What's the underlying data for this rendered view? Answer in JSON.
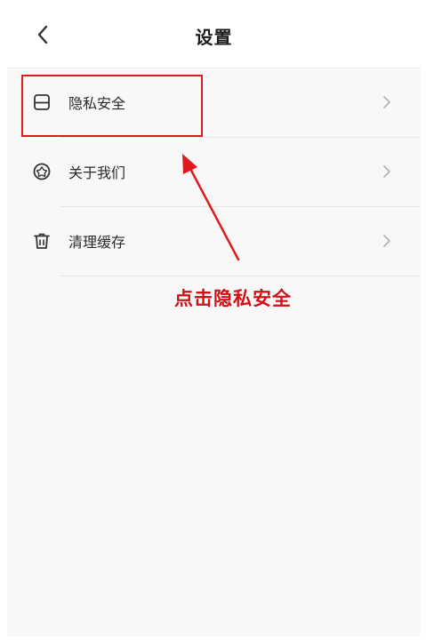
{
  "header": {
    "title": "设置",
    "back_icon": "chevron-left-icon"
  },
  "menu": {
    "items": [
      {
        "label": "隐私安全",
        "icon": "privacy-box-icon"
      },
      {
        "label": "关于我们",
        "icon": "badge-icon"
      },
      {
        "label": "清理缓存",
        "icon": "trash-icon"
      }
    ]
  },
  "annotation": {
    "text": "点击隐私安全",
    "color": "#e0191f"
  },
  "colors": {
    "background": "#f8f8f8",
    "header_bg": "#ffffff",
    "divider": "#e6e6e6",
    "chevron": "#b5b5b5"
  }
}
